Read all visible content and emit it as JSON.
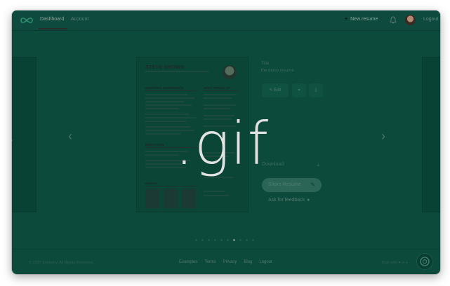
{
  "nav": {
    "tabs": [
      {
        "label": "Dashboard"
      },
      {
        "label": "Account"
      }
    ],
    "new_resume": "New resume",
    "logout": "Logout"
  },
  "resume": {
    "name": "STEVE BROWN",
    "sections": {
      "experience": "EDITORIAL EXPERIENCE",
      "proud": "MOST PROUD OF",
      "education": "EDUCATION",
      "books": "BOOKS"
    }
  },
  "sidebar": {
    "title_label": "Title",
    "title_value": "the demo resume",
    "edit": "Edit",
    "download": "Download",
    "share": "Share Resume",
    "feedback": "Ask for feedback"
  },
  "pager": {
    "count": 10,
    "active_index": 6
  },
  "overlay": {
    "text": ".gif"
  },
  "footer": {
    "copyright": "© 2017 Enhancv. All Rights Reserved.",
    "links": [
      {
        "label": "Examples"
      },
      {
        "label": "Terms"
      },
      {
        "label": "Privacy"
      },
      {
        "label": "Blog"
      },
      {
        "label": "Logout"
      }
    ],
    "made_with": "Built with ♥ in ♦"
  },
  "colors": {
    "background": "#0c4a3c",
    "overlay_text": "#e2e2e2"
  }
}
